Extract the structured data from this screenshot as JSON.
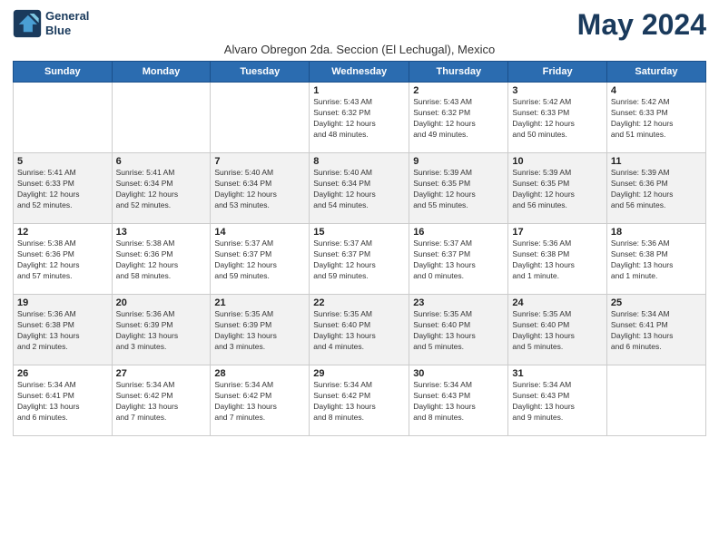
{
  "logo": {
    "line1": "General",
    "line2": "Blue"
  },
  "title": "May 2024",
  "subtitle": "Alvaro Obregon 2da. Seccion (El Lechugal), Mexico",
  "days_of_week": [
    "Sunday",
    "Monday",
    "Tuesday",
    "Wednesday",
    "Thursday",
    "Friday",
    "Saturday"
  ],
  "weeks": [
    [
      {
        "day": "",
        "info": ""
      },
      {
        "day": "",
        "info": ""
      },
      {
        "day": "",
        "info": ""
      },
      {
        "day": "1",
        "info": "Sunrise: 5:43 AM\nSunset: 6:32 PM\nDaylight: 12 hours\nand 48 minutes."
      },
      {
        "day": "2",
        "info": "Sunrise: 5:43 AM\nSunset: 6:32 PM\nDaylight: 12 hours\nand 49 minutes."
      },
      {
        "day": "3",
        "info": "Sunrise: 5:42 AM\nSunset: 6:33 PM\nDaylight: 12 hours\nand 50 minutes."
      },
      {
        "day": "4",
        "info": "Sunrise: 5:42 AM\nSunset: 6:33 PM\nDaylight: 12 hours\nand 51 minutes."
      }
    ],
    [
      {
        "day": "5",
        "info": "Sunrise: 5:41 AM\nSunset: 6:33 PM\nDaylight: 12 hours\nand 52 minutes."
      },
      {
        "day": "6",
        "info": "Sunrise: 5:41 AM\nSunset: 6:34 PM\nDaylight: 12 hours\nand 52 minutes."
      },
      {
        "day": "7",
        "info": "Sunrise: 5:40 AM\nSunset: 6:34 PM\nDaylight: 12 hours\nand 53 minutes."
      },
      {
        "day": "8",
        "info": "Sunrise: 5:40 AM\nSunset: 6:34 PM\nDaylight: 12 hours\nand 54 minutes."
      },
      {
        "day": "9",
        "info": "Sunrise: 5:39 AM\nSunset: 6:35 PM\nDaylight: 12 hours\nand 55 minutes."
      },
      {
        "day": "10",
        "info": "Sunrise: 5:39 AM\nSunset: 6:35 PM\nDaylight: 12 hours\nand 56 minutes."
      },
      {
        "day": "11",
        "info": "Sunrise: 5:39 AM\nSunset: 6:36 PM\nDaylight: 12 hours\nand 56 minutes."
      }
    ],
    [
      {
        "day": "12",
        "info": "Sunrise: 5:38 AM\nSunset: 6:36 PM\nDaylight: 12 hours\nand 57 minutes."
      },
      {
        "day": "13",
        "info": "Sunrise: 5:38 AM\nSunset: 6:36 PM\nDaylight: 12 hours\nand 58 minutes."
      },
      {
        "day": "14",
        "info": "Sunrise: 5:37 AM\nSunset: 6:37 PM\nDaylight: 12 hours\nand 59 minutes."
      },
      {
        "day": "15",
        "info": "Sunrise: 5:37 AM\nSunset: 6:37 PM\nDaylight: 12 hours\nand 59 minutes."
      },
      {
        "day": "16",
        "info": "Sunrise: 5:37 AM\nSunset: 6:37 PM\nDaylight: 13 hours\nand 0 minutes."
      },
      {
        "day": "17",
        "info": "Sunrise: 5:36 AM\nSunset: 6:38 PM\nDaylight: 13 hours\nand 1 minute."
      },
      {
        "day": "18",
        "info": "Sunrise: 5:36 AM\nSunset: 6:38 PM\nDaylight: 13 hours\nand 1 minute."
      }
    ],
    [
      {
        "day": "19",
        "info": "Sunrise: 5:36 AM\nSunset: 6:38 PM\nDaylight: 13 hours\nand 2 minutes."
      },
      {
        "day": "20",
        "info": "Sunrise: 5:36 AM\nSunset: 6:39 PM\nDaylight: 13 hours\nand 3 minutes."
      },
      {
        "day": "21",
        "info": "Sunrise: 5:35 AM\nSunset: 6:39 PM\nDaylight: 13 hours\nand 3 minutes."
      },
      {
        "day": "22",
        "info": "Sunrise: 5:35 AM\nSunset: 6:40 PM\nDaylight: 13 hours\nand 4 minutes."
      },
      {
        "day": "23",
        "info": "Sunrise: 5:35 AM\nSunset: 6:40 PM\nDaylight: 13 hours\nand 5 minutes."
      },
      {
        "day": "24",
        "info": "Sunrise: 5:35 AM\nSunset: 6:40 PM\nDaylight: 13 hours\nand 5 minutes."
      },
      {
        "day": "25",
        "info": "Sunrise: 5:34 AM\nSunset: 6:41 PM\nDaylight: 13 hours\nand 6 minutes."
      }
    ],
    [
      {
        "day": "26",
        "info": "Sunrise: 5:34 AM\nSunset: 6:41 PM\nDaylight: 13 hours\nand 6 minutes."
      },
      {
        "day": "27",
        "info": "Sunrise: 5:34 AM\nSunset: 6:42 PM\nDaylight: 13 hours\nand 7 minutes."
      },
      {
        "day": "28",
        "info": "Sunrise: 5:34 AM\nSunset: 6:42 PM\nDaylight: 13 hours\nand 7 minutes."
      },
      {
        "day": "29",
        "info": "Sunrise: 5:34 AM\nSunset: 6:42 PM\nDaylight: 13 hours\nand 8 minutes."
      },
      {
        "day": "30",
        "info": "Sunrise: 5:34 AM\nSunset: 6:43 PM\nDaylight: 13 hours\nand 8 minutes."
      },
      {
        "day": "31",
        "info": "Sunrise: 5:34 AM\nSunset: 6:43 PM\nDaylight: 13 hours\nand 9 minutes."
      },
      {
        "day": "",
        "info": ""
      }
    ]
  ]
}
